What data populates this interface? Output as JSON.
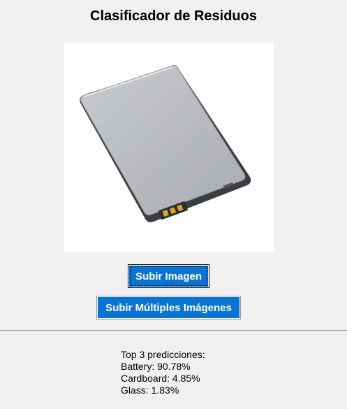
{
  "app": {
    "title": "Clasificador de Residuos"
  },
  "preview": {
    "icon": "battery-image"
  },
  "buttons": {
    "upload_single": "Subir Imagen",
    "upload_multiple": "Subir Múltiples Imágenes"
  },
  "results": {
    "heading": "Top 3 predicciones:",
    "predictions": [
      "Battery: 90.78%",
      "Cardboard: 4.85%",
      "Glass: 1.83%"
    ]
  },
  "colors": {
    "background": "#f0f0f0",
    "button": "#0a73d3",
    "button_text": "#ffffff"
  }
}
